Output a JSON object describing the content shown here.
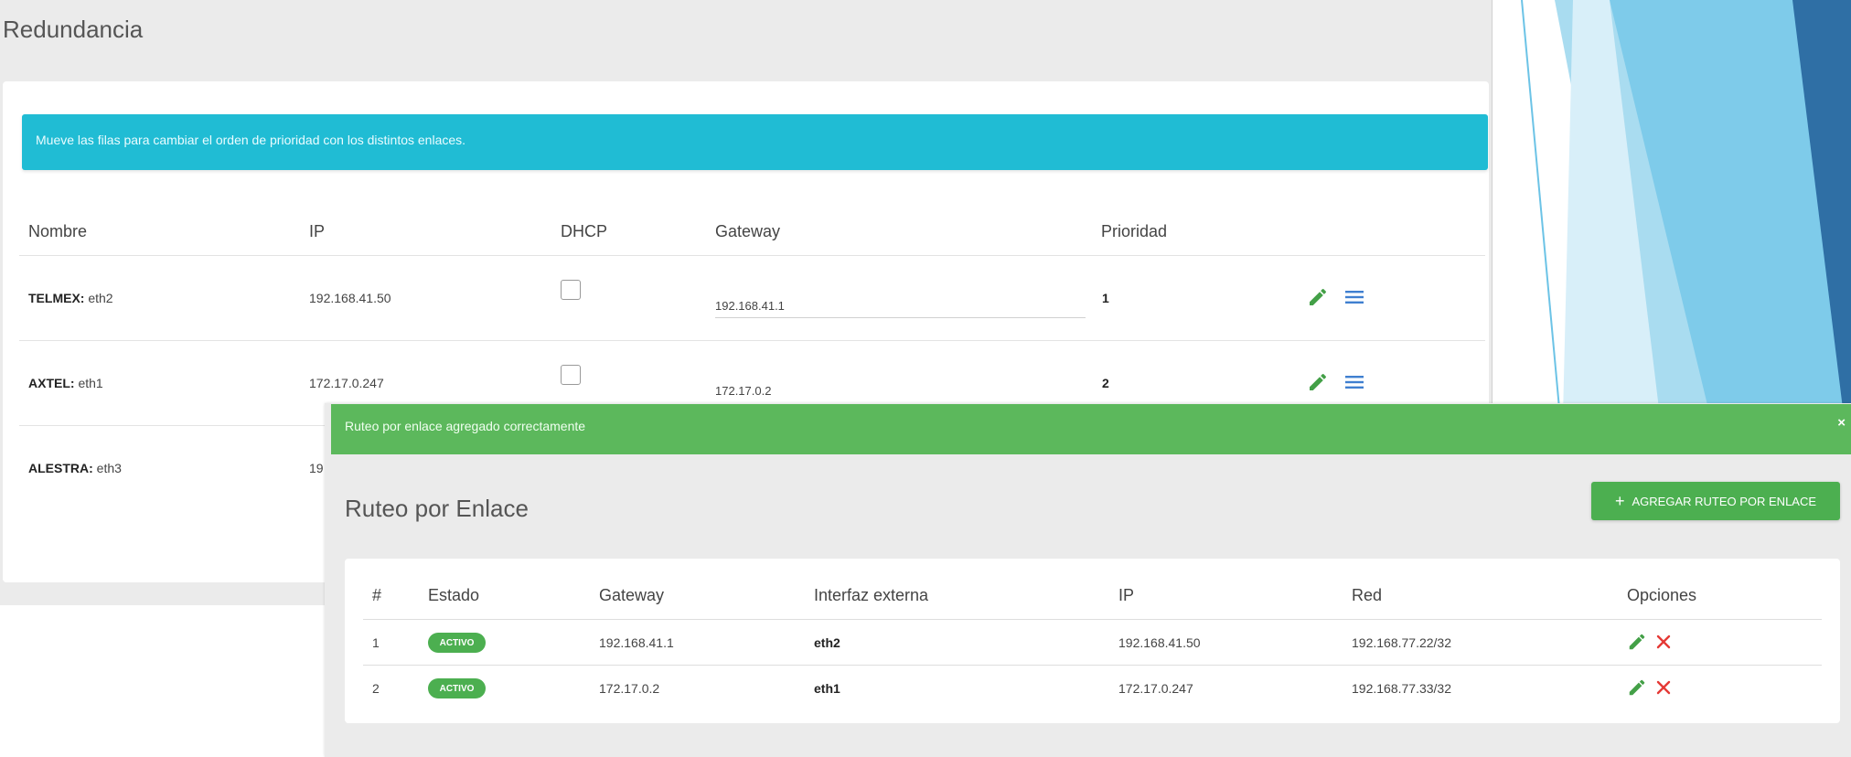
{
  "redundancia": {
    "title": "Redundancia",
    "info": "Mueve las filas para cambiar el orden de prioridad con los distintos enlaces.",
    "headers": [
      "Nombre",
      "IP",
      "DHCP",
      "Gateway",
      "Prioridad"
    ],
    "rows": [
      {
        "name": "TELMEX:",
        "iface": "eth2",
        "ip": "192.168.41.50",
        "dhcp": false,
        "gateway": "192.168.41.1",
        "priority": "1"
      },
      {
        "name": "AXTEL:",
        "iface": "eth1",
        "ip": "172.17.0.247",
        "dhcp": false,
        "gateway": "172.17.0.2",
        "priority": "2"
      },
      {
        "name": "ALESTRA:",
        "iface": "eth3",
        "ip": "19"
      }
    ]
  },
  "ruteo": {
    "success": "Ruteo por enlace agregado correctamente",
    "close": "×",
    "title": "Ruteo por Enlace",
    "add_plus": "+",
    "add_label": "AGREGAR RUTEO POR ENLACE",
    "headers": [
      "#",
      "Estado",
      "Gateway",
      "Interfaz externa",
      "IP",
      "Red",
      "Opciones"
    ],
    "rows": [
      {
        "num": "1",
        "estado": "ACTIVO",
        "gateway": "192.168.41.1",
        "iface": "eth2",
        "ip": "192.168.41.50",
        "red": "192.168.77.22/32"
      },
      {
        "num": "2",
        "estado": "ACTIVO",
        "gateway": "172.17.0.2",
        "iface": "eth1",
        "ip": "172.17.0.247",
        "red": "192.168.77.33/32"
      }
    ]
  },
  "colors": {
    "info": "#20bcd4",
    "success": "#5cb85c",
    "button": "#4caf50",
    "edit": "#43a047",
    "delete": "#e53935",
    "drag": "#3f7fd0"
  },
  "icons": [
    "pencil-icon",
    "drag-handle-icon",
    "close-x-icon",
    "plus-icon"
  ]
}
